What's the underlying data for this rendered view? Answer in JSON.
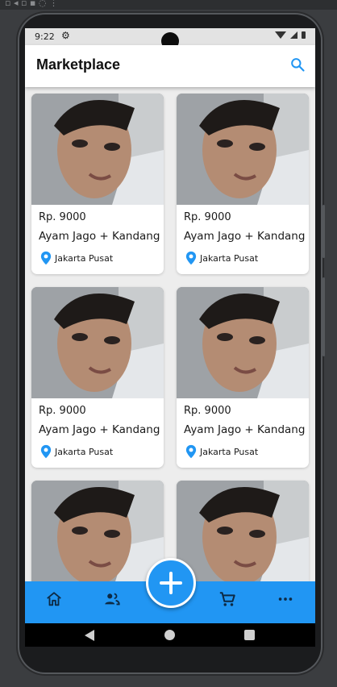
{
  "status_bar": {
    "time": "9:22"
  },
  "app_bar": {
    "title": "Marketplace"
  },
  "products": [
    {
      "price": "Rp. 9000",
      "name": "Ayam Jago + Kandang",
      "location": "Jakarta Pusat"
    },
    {
      "price": "Rp. 9000",
      "name": "Ayam Jago + Kandang",
      "location": "Jakarta Pusat"
    },
    {
      "price": "Rp. 9000",
      "name": "Ayam Jago + Kandang",
      "location": "Jakarta Pusat"
    },
    {
      "price": "Rp. 9000",
      "name": "Ayam Jago + Kandang",
      "location": "Jakarta Pusat"
    },
    {
      "price": "",
      "name": "",
      "location": ""
    },
    {
      "price": "",
      "name": "",
      "location": ""
    }
  ],
  "bottom_nav": {
    "items": [
      {
        "icon": "home-icon"
      },
      {
        "icon": "people-icon"
      },
      {
        "icon": "add-icon"
      },
      {
        "icon": "cart-icon"
      },
      {
        "icon": "more-horiz-icon"
      }
    ]
  },
  "colors": {
    "primary": "#2196f3",
    "app_bar_bg": "#ffffff",
    "screen_bg": "#ededed"
  }
}
